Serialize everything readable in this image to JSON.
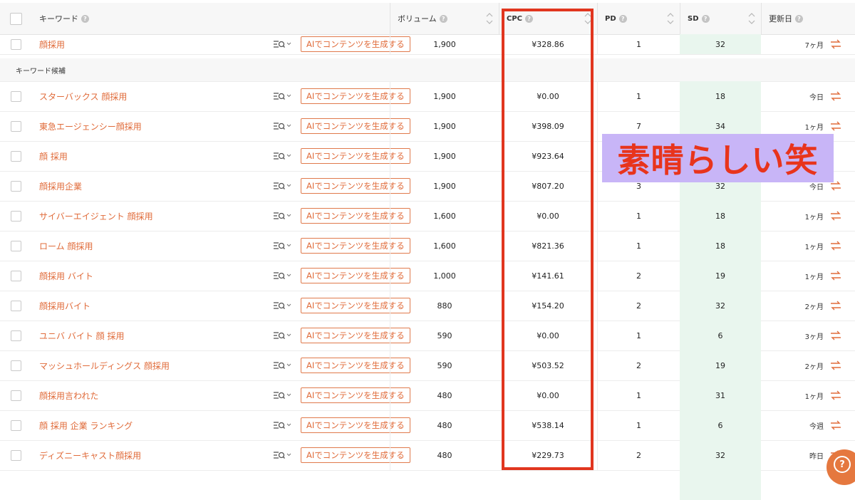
{
  "header": {
    "keyword": "キーワード",
    "volume": "ボリューム",
    "cpc": "CPC",
    "pd": "PD",
    "sd": "SD",
    "updated": "更新日",
    "help": "?"
  },
  "group_label": "キーワード候補",
  "ai_button_label": "AIでコンテンツを生成する",
  "main_row": {
    "keyword": "顔採用",
    "volume": "1,900",
    "cpc": "¥328.86",
    "pd": "1",
    "sd": "32",
    "updated": "7ヶ月"
  },
  "rows": [
    {
      "keyword": "スターバックス 顔採用",
      "volume": "1,900",
      "cpc": "¥0.00",
      "pd": "1",
      "sd": "18",
      "updated": "今日"
    },
    {
      "keyword": "東急エージェンシー顔採用",
      "volume": "1,900",
      "cpc": "¥398.09",
      "pd": "7",
      "sd": "34",
      "updated": "1ヶ月"
    },
    {
      "keyword": "顔 採用",
      "volume": "1,900",
      "cpc": "¥923.64",
      "pd": "",
      "sd": "",
      "updated": ""
    },
    {
      "keyword": "顔採用企業",
      "volume": "1,900",
      "cpc": "¥807.20",
      "pd": "3",
      "sd": "32",
      "updated": "今日"
    },
    {
      "keyword": "サイバーエイジェント 顔採用",
      "volume": "1,600",
      "cpc": "¥0.00",
      "pd": "1",
      "sd": "18",
      "updated": "1ヶ月"
    },
    {
      "keyword": "ローム 顔採用",
      "volume": "1,600",
      "cpc": "¥821.36",
      "pd": "1",
      "sd": "18",
      "updated": "1ヶ月"
    },
    {
      "keyword": "顔採用 バイト",
      "volume": "1,000",
      "cpc": "¥141.61",
      "pd": "2",
      "sd": "19",
      "updated": "1ヶ月"
    },
    {
      "keyword": "顔採用バイト",
      "volume": "880",
      "cpc": "¥154.20",
      "pd": "2",
      "sd": "32",
      "updated": "2ヶ月"
    },
    {
      "keyword": "ユニバ バイト 顔 採用",
      "volume": "590",
      "cpc": "¥0.00",
      "pd": "1",
      "sd": "6",
      "updated": "3ヶ月"
    },
    {
      "keyword": "マッシュホールディングス 顔採用",
      "volume": "590",
      "cpc": "¥503.52",
      "pd": "2",
      "sd": "19",
      "updated": "2ヶ月"
    },
    {
      "keyword": "顔採用言われた",
      "volume": "480",
      "cpc": "¥0.00",
      "pd": "1",
      "sd": "31",
      "updated": "1ヶ月"
    },
    {
      "keyword": "顔 採用 企業 ランキング",
      "volume": "480",
      "cpc": "¥538.14",
      "pd": "1",
      "sd": "6",
      "updated": "今週"
    },
    {
      "keyword": "ディズニーキャスト顔採用",
      "volume": "480",
      "cpc": "¥229.73",
      "pd": "2",
      "sd": "32",
      "updated": "昨日"
    }
  ],
  "overlay_text": "素晴らしい笑",
  "colors": {
    "accent": "#e06b3a",
    "highlight_frame": "#e1361f",
    "overlay_bg": "#c8b5f7",
    "sd_bg": "#e9f6ee"
  }
}
